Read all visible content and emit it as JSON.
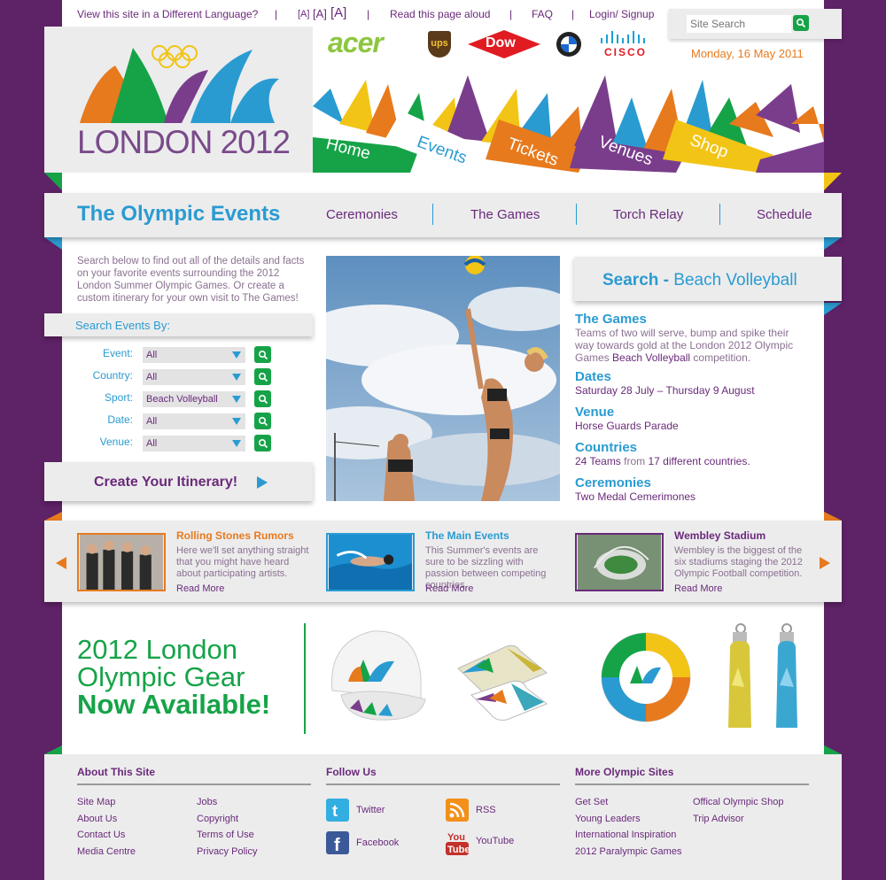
{
  "topnav": {
    "language": "View this site in a Different Language?",
    "font_sizes": [
      "[A]",
      "[A]",
      "[A]"
    ],
    "read_aloud": "Read this page aloud",
    "faq": "FAQ",
    "login": "Login/ Signup"
  },
  "search": {
    "placeholder": "Site Search"
  },
  "date": "Monday, 16 May 2011",
  "logo": {
    "text_london": "LONDON",
    "text_year": "2012"
  },
  "sponsors": {
    "acer": "acer",
    "ups": "ups",
    "dow": "Dow",
    "cisco": "CISCO"
  },
  "tabs": [
    "Home",
    "Events",
    "Tickets",
    "Venues",
    "Shop"
  ],
  "subnav": {
    "title": "The Olympic Events",
    "links": [
      "Ceremonies",
      "The Games",
      "Torch Relay",
      "Schedule"
    ]
  },
  "intro": "Search below to find out all of the details and facts on your favorite events surrounding the 2012 London Summer Olympic Games. Or create a custom itinerary for your own visit to The Games!",
  "search_form": {
    "title": "Search Events By:",
    "fields": [
      {
        "label": "Event:",
        "value": "All"
      },
      {
        "label": "Country:",
        "value": "All"
      },
      {
        "label": "Sport:",
        "value": "Beach Volleyball"
      },
      {
        "label": "Date:",
        "value": "All"
      },
      {
        "label": "Venue:",
        "value": "All"
      }
    ]
  },
  "itinerary": "Create Your Itinerary!",
  "result": {
    "prefix": "Search - ",
    "sport": "Beach Volleyball",
    "games_title": "The Games",
    "games_text_1": "Teams of two will serve, bump and spike their way towards gold at the London 2012 Olympic Games ",
    "games_text_link": "Beach Volleyball",
    "games_text_2": " competition.",
    "dates_title": "Dates",
    "dates_text": "Saturday 28 July – Thursday 9 August",
    "venue_title": "Venue",
    "venue_text": "Horse Guards Parade",
    "countries_title": "Countries",
    "countries_teams": "24 Teams",
    "countries_from": " from ",
    "countries_count": "17 different countries",
    "countries_end": ".",
    "ceremonies_title": "Ceremonies",
    "ceremonies_text": "Two Medal Cemerimones"
  },
  "news": [
    {
      "title": "Rolling Stones Rumors",
      "text": "Here we'll set anything straight that you might have heard about participating artists.",
      "more": "Read More",
      "color": "#e77a1d"
    },
    {
      "title": "The Main Events",
      "text": "This Summer's events are sure to be sizzling with passion between competing countries.",
      "more": "Read More",
      "color": "#2a9bd1"
    },
    {
      "title": "Wembley Stadium",
      "text": "Wembley is the biggest of the six stadiums staging the 2012 Olympic Football competition.",
      "more": "Read More",
      "color": "#6a2a7a"
    }
  ],
  "gear": {
    "line1": "2012 London",
    "line2": "Olympic Gear",
    "line3": "Now Available!"
  },
  "footer": {
    "about_title": "About This Site",
    "about_col1": [
      "Site Map",
      "About Us",
      "Contact Us",
      "Media Centre"
    ],
    "about_col2": [
      "Jobs",
      "Copyright",
      "Terms of Use",
      "Privacy Policy"
    ],
    "follow_title": "Follow Us",
    "twitter": "Twitter",
    "facebook": "Facebook",
    "rss": "RSS",
    "youtube": "YouTube",
    "more_title": "More Olympic Sites",
    "more_col1": [
      "Get Set",
      "Young Leaders",
      "International Inspiration",
      "2012 Paralympic Games"
    ],
    "more_col2": [
      "Offical Olympic Shop",
      "Trip Advisor"
    ]
  },
  "colors": {
    "purple": "#6a2a7a",
    "blue": "#2a9bd1",
    "green": "#16a348",
    "orange": "#e77a1d",
    "background": "#5e2266"
  }
}
